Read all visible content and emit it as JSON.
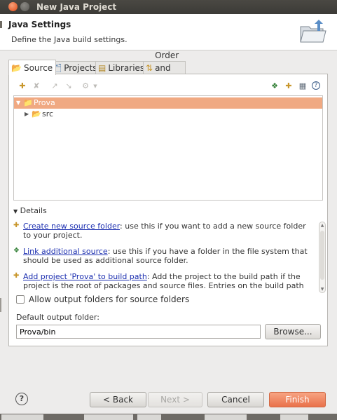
{
  "window": {
    "title": "New Java Project"
  },
  "header": {
    "title": "Java Settings",
    "description": "Define the Java build settings.",
    "icon": "folder-build-icon"
  },
  "tabs": [
    {
      "label": "Source",
      "icon": "source-folder-icon",
      "active": true
    },
    {
      "label": "Projects",
      "icon": "projects-icon",
      "active": false
    },
    {
      "label": "Libraries",
      "icon": "libraries-icon",
      "active": false
    },
    {
      "label": "Order and Export",
      "icon": "order-export-icon",
      "active": false
    }
  ],
  "tree": {
    "project": "Prova",
    "children": [
      "src"
    ]
  },
  "details": {
    "label": "Details",
    "items": [
      {
        "link": "Create new source folder",
        "text": ": use this if you want to add a new source folder to your project."
      },
      {
        "link": "Link additional source",
        "text": ": use this if you have a folder in the file system that should be used as additional source folder."
      },
      {
        "link": "Add project 'Prova' to build path",
        "text": ": Add the project to the build path if the project is the root of packages and source files. Entries on the build path are visible to the compiler and used for building."
      }
    ]
  },
  "options": {
    "allow_output_folders_label": "Allow output folders for source folders",
    "allow_output_folders_checked": false
  },
  "output": {
    "label": "Default output folder:",
    "value": "Prova/bin",
    "browse_label": "Browse..."
  },
  "footer": {
    "help_symbol": "?",
    "back_label": "< Back",
    "next_label": "Next >",
    "cancel_label": "Cancel",
    "finish_label": "Finish"
  },
  "colors": {
    "accent": "#e9714a",
    "selection": "#f0a982",
    "link": "#1c2fb0"
  }
}
